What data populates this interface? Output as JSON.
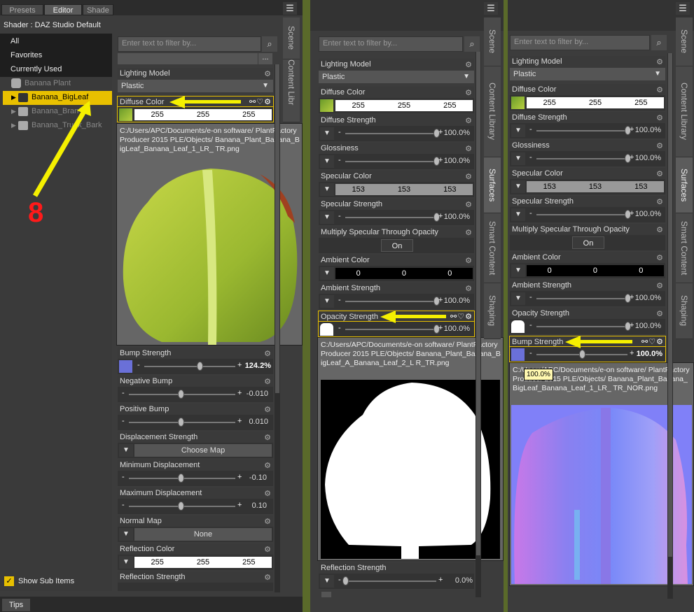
{
  "left_panel": {
    "tabs": [
      "Presets",
      "Editor",
      "Shade"
    ],
    "shader_label": "Shader : DAZ Studio Default",
    "filters": [
      "All",
      "Favorites",
      "Currently Used"
    ],
    "tree": {
      "root": "Banana Plant",
      "children": [
        "Banana_BigLeaf",
        "Banana_Bran",
        "Banana_Trunk_Bark"
      ]
    },
    "show_sub_items": "Show Sub Items",
    "annotation_number": "8"
  },
  "vertical_tabs": [
    "Scene",
    "Content Library",
    "Surfaces",
    "Smart Content",
    "Shaping"
  ],
  "vertical_tabs_truncated": [
    "Scene",
    "Content Libr"
  ],
  "filter_placeholder": "Enter text to filter by...",
  "ellipsis": "...",
  "col1": {
    "lighting_model": {
      "label": "Lighting Model",
      "value": "Plastic"
    },
    "diffuse_color": {
      "label": "Diffuse Color",
      "r": "255",
      "g": "255",
      "b": "255"
    },
    "tooltip_path": "C:/Users/APC/Documents/e-on software/ PlantFactory Producer 2015 PLE/Objects/ Banana_Plant_Banana_BigLeaf_Banana_Leaf_1_LR_ TR.png",
    "bump_strength": {
      "label": "Bump Strength",
      "value": "124.2%"
    },
    "negative_bump": {
      "label": "Negative Bump",
      "value": "-0.010"
    },
    "positive_bump": {
      "label": "Positive Bump",
      "value": "0.010"
    },
    "displacement_strength": {
      "label": "Displacement Strength",
      "button": "Choose Map"
    },
    "minimum_displacement": {
      "label": "Minimum Displacement",
      "value": "-0.10"
    },
    "maximum_displacement": {
      "label": "Maximum Displacement",
      "value": "0.10"
    },
    "normal_map": {
      "label": "Normal Map",
      "button": "None"
    },
    "reflection_color": {
      "label": "Reflection Color",
      "r": "255",
      "g": "255",
      "b": "255"
    },
    "reflection_strength": {
      "label": "Reflection Strength"
    }
  },
  "col2": {
    "lighting_model": {
      "label": "Lighting Model",
      "value": "Plastic"
    },
    "diffuse_color": {
      "label": "Diffuse Color",
      "r": "255",
      "g": "255",
      "b": "255"
    },
    "diffuse_strength": {
      "label": "Diffuse Strength",
      "value": "100.0%"
    },
    "glossiness": {
      "label": "Glossiness",
      "value": "100.0%"
    },
    "specular_color": {
      "label": "Specular Color",
      "r": "153",
      "g": "153",
      "b": "153"
    },
    "specular_strength": {
      "label": "Specular Strength",
      "value": "100.0%"
    },
    "multiply_specular": {
      "label": "Multiply Specular Through Opacity",
      "button": "On"
    },
    "ambient_color": {
      "label": "Ambient Color",
      "r": "0",
      "g": "0",
      "b": "0"
    },
    "ambient_strength": {
      "label": "Ambient Strength",
      "value": "100.0%"
    },
    "opacity_strength": {
      "label": "Opacity Strength",
      "value": "100.0%"
    },
    "tooltip_path": "C:/Users/APC/Documents/e-on software/ PlantFactory Producer 2015 PLE/Objects/ Banana_Plant_Banana_BigLeaf_A_Banana_Leaf_2_L R_TR.png",
    "reflection_strength": {
      "label": "Reflection Strength",
      "value": "0.0%"
    }
  },
  "col3": {
    "lighting_model": {
      "label": "Lighting Model",
      "value": "Plastic"
    },
    "diffuse_color": {
      "label": "Diffuse Color",
      "r": "255",
      "g": "255",
      "b": "255"
    },
    "diffuse_strength": {
      "label": "Diffuse Strength",
      "value": "100.0%"
    },
    "glossiness": {
      "label": "Glossiness",
      "value": "100.0%"
    },
    "specular_color": {
      "label": "Specular Color",
      "r": "153",
      "g": "153",
      "b": "153"
    },
    "specular_strength": {
      "label": "Specular Strength",
      "value": "100.0%"
    },
    "multiply_specular": {
      "label": "Multiply Specular Through Opacity",
      "button": "On"
    },
    "ambient_color": {
      "label": "Ambient Color",
      "r": "0",
      "g": "0",
      "b": "0"
    },
    "ambient_strength": {
      "label": "Ambient Strength",
      "value": "100.0%"
    },
    "opacity_strength": {
      "label": "Opacity Strength",
      "value": "100.0%"
    },
    "bump_strength": {
      "label": "Bump Strength",
      "value": "100.0%"
    },
    "bump_tooltip": "100.0%",
    "tooltip_path": "C:/Users/APC/Documents/e-on software/ PlantFactory Producer 2015 PLE/Objects/ Banana_Plant_Banana_BigLeaf_Banana_Leaf_1_LR_ TR_NOR.png"
  },
  "bottom": {
    "tips": "Tips"
  },
  "colors": {
    "accent": "#e8c000",
    "arrow": "#f5f000",
    "annotation": "#ff1a1a"
  }
}
